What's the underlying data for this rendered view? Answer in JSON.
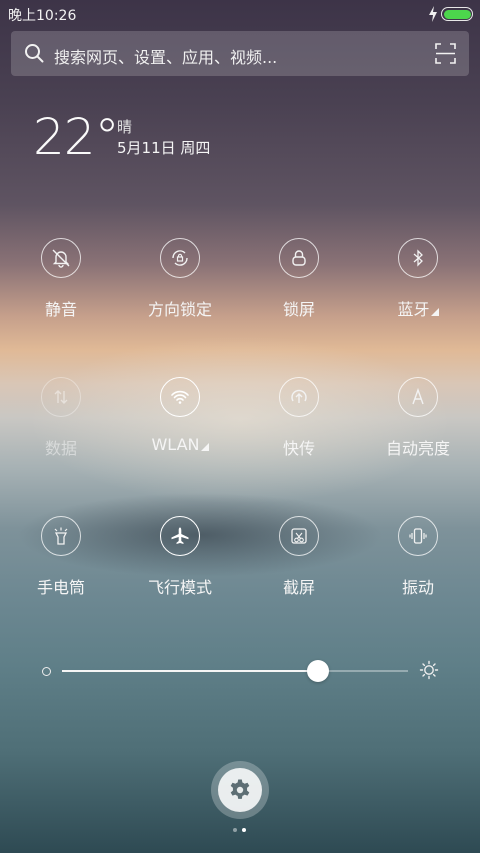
{
  "status": {
    "time": "晚上10:26"
  },
  "search": {
    "placeholder": "搜索网页、设置、应用、视频..."
  },
  "weather": {
    "temperature": "22°",
    "condition": "晴",
    "date": "5月11日 周四"
  },
  "toggles": [
    {
      "label": "静音",
      "icon": "bell-off-icon",
      "state": "off"
    },
    {
      "label": "方向锁定",
      "icon": "rotation-lock-icon",
      "state": "off"
    },
    {
      "label": "锁屏",
      "icon": "lock-icon",
      "state": "off"
    },
    {
      "label": "蓝牙",
      "icon": "bluetooth-icon",
      "state": "off",
      "has_menu": true
    },
    {
      "label": "数据",
      "icon": "mobile-data-icon",
      "state": "disabled"
    },
    {
      "label": "WLAN",
      "icon": "wifi-icon",
      "state": "on",
      "has_menu": true
    },
    {
      "label": "快传",
      "icon": "quick-transfer-icon",
      "state": "off"
    },
    {
      "label": "自动亮度",
      "icon": "auto-brightness-icon",
      "state": "off"
    },
    {
      "label": "手电筒",
      "icon": "flashlight-icon",
      "state": "off"
    },
    {
      "label": "飞行模式",
      "icon": "airplane-icon",
      "state": "on"
    },
    {
      "label": "截屏",
      "icon": "screenshot-icon",
      "state": "off"
    },
    {
      "label": "振动",
      "icon": "vibrate-icon",
      "state": "off"
    }
  ],
  "brightness": {
    "level": 0.74
  },
  "pager": {
    "pages": 2,
    "current": 2
  },
  "colors": {
    "battery": "#4cd64c"
  }
}
